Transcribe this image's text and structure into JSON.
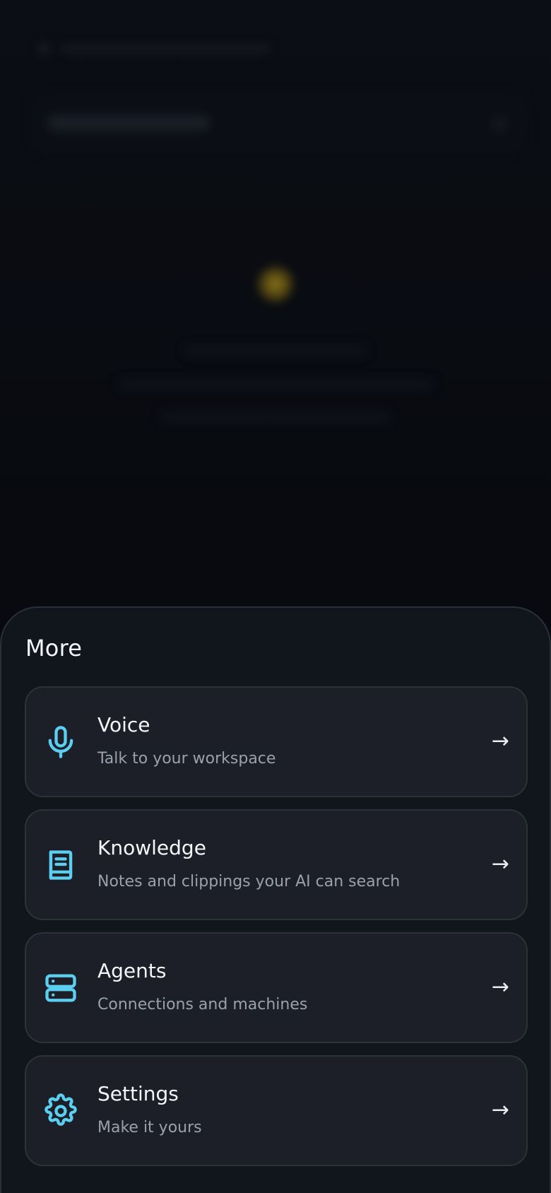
{
  "sheet": {
    "title": "More",
    "items": [
      {
        "label": "Voice",
        "subtitle": "Talk to your workspace",
        "icon": "microphone-icon",
        "arrow": "→"
      },
      {
        "label": "Knowledge",
        "subtitle": "Notes and clippings your AI can search",
        "icon": "book-icon",
        "arrow": "→"
      },
      {
        "label": "Agents",
        "subtitle": "Connections and machines",
        "icon": "server-icon",
        "arrow": "→"
      },
      {
        "label": "Settings",
        "subtitle": "Make it yours",
        "icon": "gear-icon",
        "arrow": "→"
      }
    ]
  },
  "colors": {
    "accent": "#5ccff1",
    "sheet_bg": "#11151c",
    "card_bg": "#1c1f27",
    "subtitle": "#9aa1ad"
  }
}
